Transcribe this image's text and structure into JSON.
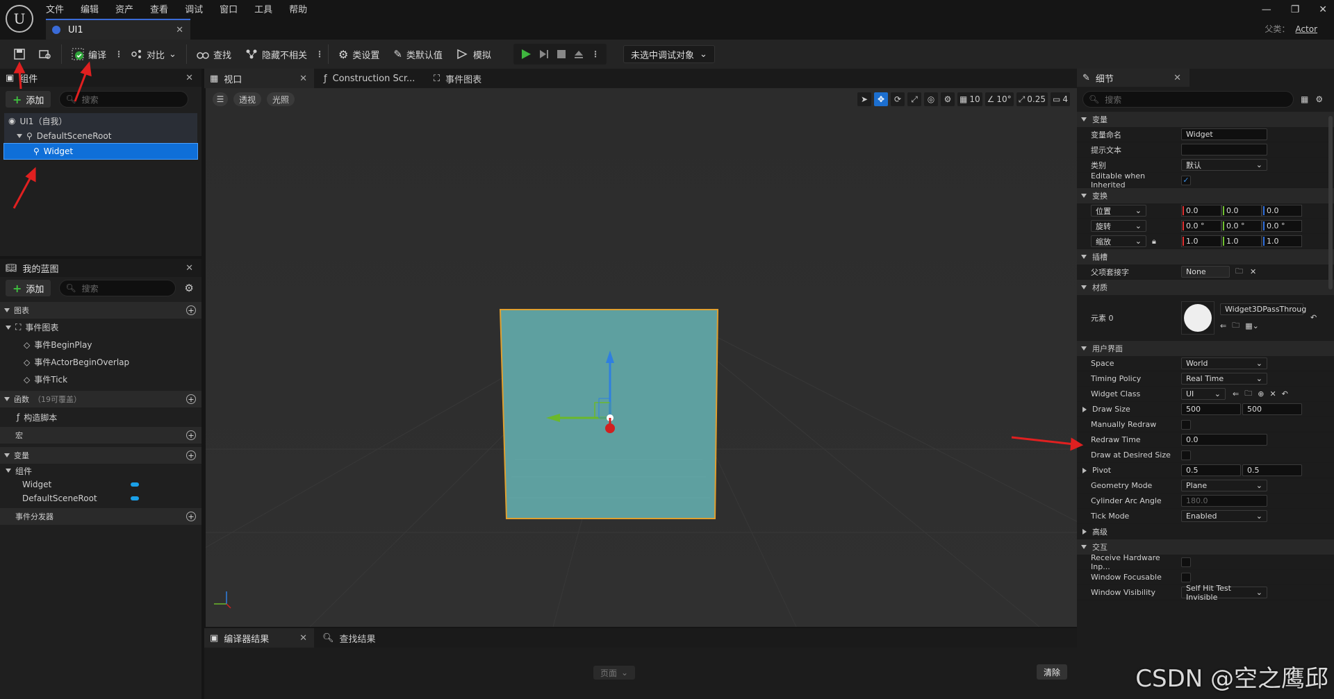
{
  "app": {
    "menu": [
      "文件",
      "编辑",
      "资产",
      "查看",
      "调试",
      "窗口",
      "工具",
      "帮助"
    ],
    "doc_tab": "UI1",
    "parent_label": "父类：",
    "parent_value": "Actor"
  },
  "toolbar": {
    "compile": "编译",
    "diff": "对比",
    "find": "查找",
    "hide_unrelated": "隐藏不相关",
    "class_settings": "类设置",
    "class_defaults": "类默认值",
    "simulate": "模拟",
    "debug_object": "未选中调试对象"
  },
  "components_panel": {
    "tab": "组件",
    "add": "添加",
    "search_placeholder": "搜索",
    "tree": [
      {
        "label": "UI1（自我）",
        "depth": 0,
        "selected": false
      },
      {
        "label": "DefaultSceneRoot",
        "depth": 1,
        "selected": false
      },
      {
        "label": "Widget",
        "depth": 2,
        "selected": true
      }
    ]
  },
  "my_blueprint": {
    "tab": "我的蓝图",
    "add": "添加",
    "search_placeholder": "搜索",
    "graphs": "图表",
    "event_graph": "事件图表",
    "events": [
      "事件BeginPlay",
      "事件ActorBeginOverlap",
      "事件Tick"
    ],
    "functions": "函数",
    "functions_count": "（19可覆盖）",
    "construction_script": "构造脚本",
    "macros": "宏",
    "variables": "变量",
    "components": "组件",
    "var_items": [
      "Widget",
      "DefaultSceneRoot"
    ],
    "event_dispatchers": "事件分发器"
  },
  "center_tabs": {
    "viewport": "视口",
    "construction": "Construction Scr...",
    "event_graph": "事件图表"
  },
  "viewport": {
    "perspective": "透视",
    "lit": "光照",
    "grid_snap": "10",
    "rot_snap": "10°",
    "scale_snap": "0.25",
    "camera_speed": "4"
  },
  "bottom": {
    "compiler_results": "编译器结果",
    "find_results": "查找结果",
    "page": "页面",
    "clear": "清除"
  },
  "details": {
    "tab": "细节",
    "search_placeholder": "搜索",
    "sec_variable": "变量",
    "var_name_label": "变量命名",
    "var_name": "Widget",
    "tooltip_label": "提示文本",
    "category_label": "类别",
    "category": "默认",
    "editable_inherited": "Editable when Inherited",
    "sec_transform": "变换",
    "location": "位置",
    "rotation": "旋转",
    "scale": "缩放",
    "loc": [
      "0.0",
      "0.0",
      "0.0"
    ],
    "rot": [
      "0.0 °",
      "0.0 °",
      "0.0 °"
    ],
    "scl": [
      "1.0",
      "1.0",
      "1.0"
    ],
    "sec_socket": "插槽",
    "parent_socket": "父项套接字",
    "socket_value": "None",
    "sec_materials": "材质",
    "element0": "元素 0",
    "material_name": "Widget3DPassThroug",
    "sec_ui": "用户界面",
    "space_label": "Space",
    "space": "World",
    "timing_label": "Timing Policy",
    "timing": "Real Time",
    "widget_class_label": "Widget Class",
    "widget_class": "UI",
    "draw_size_label": "Draw Size",
    "draw_size": [
      "500",
      "500"
    ],
    "manual_redraw": "Manually Redraw",
    "redraw_time_label": "Redraw Time",
    "redraw_time": "0.0",
    "draw_desired": "Draw at Desired Size",
    "pivot_label": "Pivot",
    "pivot": [
      "0.5",
      "0.5"
    ],
    "geometry_label": "Geometry Mode",
    "geometry": "Plane",
    "cyl_label": "Cylinder Arc Angle",
    "cyl": "180.0",
    "tick_label": "Tick Mode",
    "tick": "Enabled",
    "sec_advanced": "高级",
    "sec_interaction": "交互",
    "receive_hw": "Receive Hardware Inp...",
    "window_focus": "Window Focusable",
    "window_vis": "Window Visibility",
    "window_vis_value": "Self Hit Test Invisible"
  },
  "watermark": "CSDN @空之鹰邱"
}
